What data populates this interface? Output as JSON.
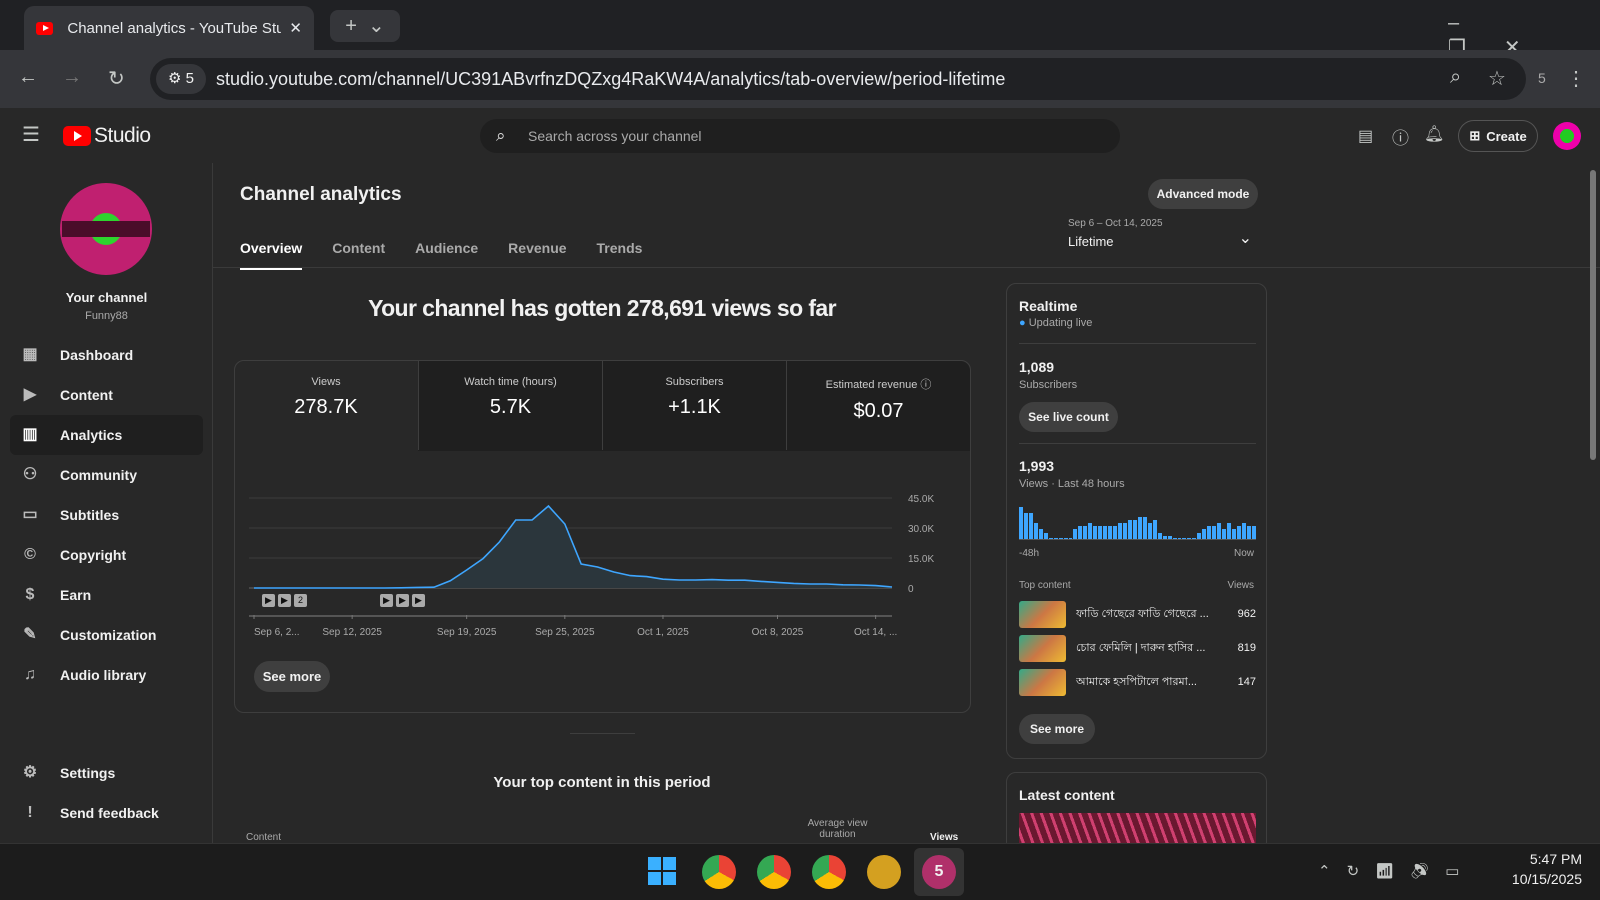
{
  "browser": {
    "tab_title": "Channel analytics - YouTube Studio",
    "url": "studio.youtube.com/channel/UC391ABvrfnzDQZxg4RaKW4A/analytics/tab-overview/period-lifetime",
    "site_badge": "5",
    "ext_count": "5"
  },
  "header": {
    "logo": "Studio",
    "search_placeholder": "Search across your channel",
    "create": "Create"
  },
  "sidebar": {
    "channel_label": "Your channel",
    "channel_name": "Funny88",
    "items": [
      {
        "label": "Dashboard"
      },
      {
        "label": "Content"
      },
      {
        "label": "Analytics"
      },
      {
        "label": "Community"
      },
      {
        "label": "Subtitles"
      },
      {
        "label": "Copyright"
      },
      {
        "label": "Earn"
      },
      {
        "label": "Customization"
      },
      {
        "label": "Audio library"
      }
    ],
    "settings": "Settings",
    "feedback": "Send feedback"
  },
  "main": {
    "title": "Channel analytics",
    "advanced": "Advanced mode",
    "tabs": [
      "Overview",
      "Content",
      "Audience",
      "Revenue",
      "Trends"
    ],
    "period_range": "Sep 6 – Oct 14, 2025",
    "period": "Lifetime",
    "headline": "Your channel has gotten 278,691 views so far",
    "metrics": [
      {
        "label": "Views",
        "value": "278.7K"
      },
      {
        "label": "Watch time (hours)",
        "value": "5.7K"
      },
      {
        "label": "Subscribers",
        "value": "+1.1K"
      },
      {
        "label": "Estimated revenue",
        "value": "$0.07"
      }
    ],
    "see_more": "See more",
    "top_content_title": "Your top content in this period",
    "col_content": "Content",
    "col_avd": "Average view duration",
    "col_views": "Views"
  },
  "chart_data": {
    "type": "area",
    "title": "Views",
    "x": [
      "Sep 6",
      "Sep 7",
      "Sep 8",
      "Sep 9",
      "Sep 10",
      "Sep 11",
      "Sep 12",
      "Sep 13",
      "Sep 14",
      "Sep 15",
      "Sep 16",
      "Sep 17",
      "Sep 18",
      "Sep 19",
      "Sep 20",
      "Sep 21",
      "Sep 22",
      "Sep 23",
      "Sep 24",
      "Sep 25",
      "Sep 26",
      "Sep 27",
      "Sep 28",
      "Sep 29",
      "Sep 30",
      "Oct 1",
      "Oct 2",
      "Oct 3",
      "Oct 4",
      "Oct 5",
      "Oct 6",
      "Oct 7",
      "Oct 8",
      "Oct 9",
      "Oct 10",
      "Oct 11",
      "Oct 12",
      "Oct 13",
      "Oct 14",
      "Oct 15"
    ],
    "values": [
      0,
      0,
      0,
      0,
      0,
      0,
      0,
      0,
      0,
      100,
      300,
      400,
      3600,
      9000,
      14700,
      23000,
      34000,
      34000,
      41000,
      32000,
      12000,
      10500,
      8000,
      6200,
      5700,
      4400,
      4000,
      4000,
      4200,
      3900,
      3900,
      3300,
      2800,
      2300,
      2000,
      2000,
      1600,
      1500,
      1200,
      500
    ],
    "tick_labels": [
      "Sep 6, 2...",
      "Sep 12, 2025",
      "Sep 19, 2025",
      "Sep 25, 2025",
      "Oct 1, 2025",
      "Oct 8, 2025",
      "Oct 14, ..."
    ],
    "tick_index": [
      0,
      6,
      13,
      19,
      25,
      32,
      38
    ],
    "y_ticks": [
      "45.0K",
      "30.0K",
      "15.0K",
      "0"
    ],
    "ylim": [
      0,
      45000
    ],
    "grid": true,
    "color": "#3ea6ff"
  },
  "realtime": {
    "title": "Realtime",
    "status": "Updating live",
    "subs": "1,089",
    "subs_label": "Subscribers",
    "live_btn": "See live count",
    "views": "1,993",
    "views_label": "Views · Last 48 hours",
    "left": "-48h",
    "right": "Now",
    "bars": [
      10,
      8,
      8,
      5,
      3,
      2,
      0,
      0,
      0,
      0,
      0,
      3,
      4,
      4,
      5,
      4,
      4,
      4,
      4,
      4,
      5,
      5,
      6,
      6,
      7,
      7,
      5,
      6,
      2,
      1,
      1,
      0,
      0,
      0,
      0,
      0,
      2,
      3,
      4,
      4,
      5,
      3,
      5,
      3,
      4,
      5,
      4,
      4
    ],
    "top_label": "Top content",
    "views_col": "Views",
    "items": [
      {
        "title": "ফাডি গেছেরে ফাডি গেছেরে ...",
        "views": "962"
      },
      {
        "title": "চোর ফেমিলি | দারুন হাসির ...",
        "views": "819"
      },
      {
        "title": "আমাকে হসপিটালে পারমা...",
        "views": "147"
      }
    ],
    "see_more": "See more",
    "latest": "Latest content"
  },
  "taskbar": {
    "time": "5:47 PM",
    "date": "10/15/2025"
  }
}
